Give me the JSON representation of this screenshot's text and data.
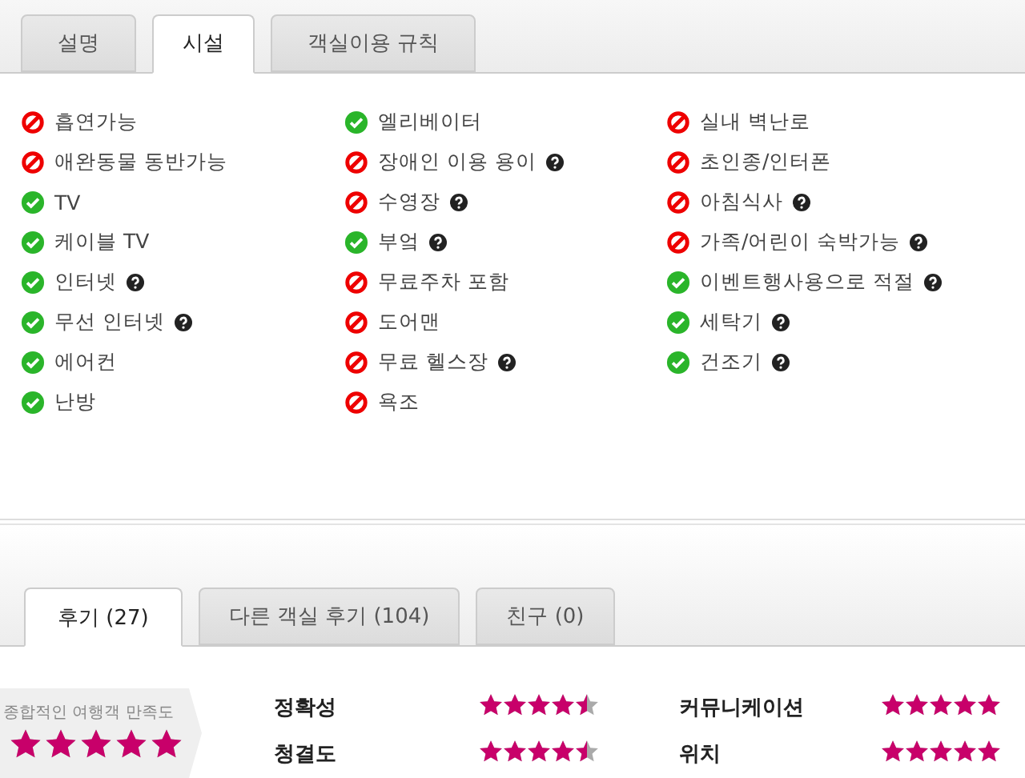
{
  "top_tabs": [
    {
      "label": "설명",
      "selected": false
    },
    {
      "label": "시설",
      "selected": true
    },
    {
      "label": "객실이용 규칙",
      "selected": false
    }
  ],
  "amenities": {
    "columns": [
      {
        "items": [
          {
            "label": "흡연가능",
            "available": false,
            "info": false
          },
          {
            "label": "애완동물 동반가능",
            "available": false,
            "info": false
          },
          {
            "label": "TV",
            "available": true,
            "info": false
          },
          {
            "label": "케이블 TV",
            "available": true,
            "info": false
          },
          {
            "label": "인터넷",
            "available": true,
            "info": true
          },
          {
            "label": "무선 인터넷",
            "available": true,
            "info": true
          },
          {
            "label": "에어컨",
            "available": true,
            "info": false
          },
          {
            "label": "난방",
            "available": true,
            "info": false
          }
        ]
      },
      {
        "items": [
          {
            "label": "엘리베이터",
            "available": true,
            "info": false
          },
          {
            "label": "장애인 이용 용이",
            "available": false,
            "info": true
          },
          {
            "label": "수영장",
            "available": false,
            "info": true
          },
          {
            "label": "부엌",
            "available": true,
            "info": true
          },
          {
            "label": "무료주차 포함",
            "available": false,
            "info": false
          },
          {
            "label": "도어맨",
            "available": false,
            "info": false
          },
          {
            "label": "무료 헬스장",
            "available": false,
            "info": true
          },
          {
            "label": "욕조",
            "available": false,
            "info": false
          }
        ]
      },
      {
        "items": [
          {
            "label": "실내 벽난로",
            "available": false,
            "info": false
          },
          {
            "label": "초인종/인터폰",
            "available": false,
            "info": false
          },
          {
            "label": "아침식사",
            "available": false,
            "info": true
          },
          {
            "label": "가족/어린이 숙박가능",
            "available": false,
            "info": true
          },
          {
            "label": "이벤트행사용으로 적절",
            "available": true,
            "info": true
          },
          {
            "label": "세탁기",
            "available": true,
            "info": true
          },
          {
            "label": "건조기",
            "available": true,
            "info": true
          }
        ]
      }
    ]
  },
  "review_tabs": [
    {
      "label": "후기 (27)",
      "selected": true
    },
    {
      "label": "다른 객실 후기 (104)",
      "selected": false
    },
    {
      "label": "친구 (0)",
      "selected": false
    }
  ],
  "overall": {
    "label": "종합적인 여행객 만족도",
    "stars": 5
  },
  "ratings": [
    {
      "label": "정확성",
      "stars": 4.5
    },
    {
      "label": "커뮤니케이션",
      "stars": 5
    },
    {
      "label": "청결도",
      "stars": 4.5
    },
    {
      "label": "위치",
      "stars": 5
    }
  ]
}
